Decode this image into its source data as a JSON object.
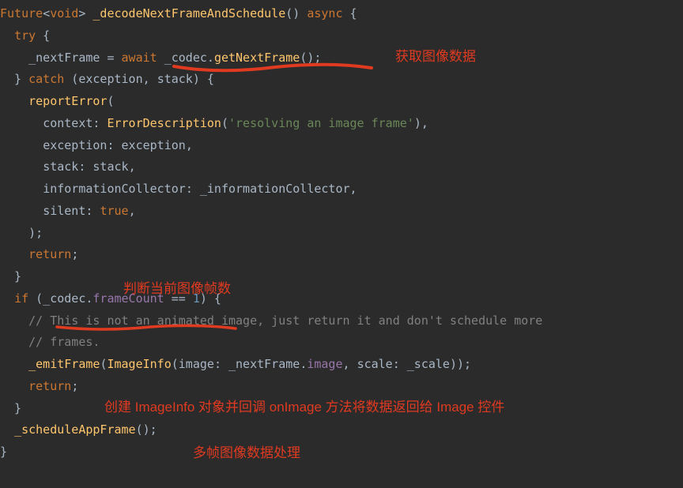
{
  "code": {
    "l1_future": "Future",
    "l1_void": "void",
    "l1_fn": "_decodeNextFrameAndSchedule",
    "l1_async": "async",
    "l2_try": "try",
    "l3_nextFrame": "_nextFrame",
    "l3_await": "await",
    "l3_codec": "_codec",
    "l3_getNextFrame": "getNextFrame",
    "l4_catch": "catch",
    "l4_exc": "exception",
    "l4_stack": "stack",
    "l5_reportError": "reportError",
    "l6_context": "context",
    "l6_ErrorDescription": "ErrorDescription",
    "l6_str": "'resolving an image frame'",
    "l7_exception_k": "exception",
    "l7_exception_v": "exception",
    "l8_stack_k": "stack",
    "l8_stack_v": "stack",
    "l9_infoColl_k": "informationCollector",
    "l9_infoColl_v": "_informationCollector",
    "l10_silent": "silent",
    "l10_true": "true",
    "l12_return": "return",
    "l14_if": "if",
    "l14_codec": "_codec",
    "l14_frameCount": "frameCount",
    "l14_num": "1",
    "l15_cmt": "// This is not an animated image, just return it and don't schedule more",
    "l16_cmt": "// frames.",
    "l17_emitFrame": "_emitFrame",
    "l17_ImageInfo": "ImageInfo",
    "l17_image_k": "image",
    "l17_nextFrame": "_nextFrame",
    "l17_image_p": "image",
    "l17_scale_k": "scale",
    "l17_scale_v": "_scale",
    "l18_return": "return",
    "l20_scheduleAppFrame": "_scheduleAppFrame"
  },
  "annotations": {
    "a1": "获取图像数据",
    "a2": "判断当前图像帧数",
    "a3": "创建 ImageInfo 对象并回调 onImage 方法将数据返回给 Image 控件",
    "a4": "多帧图像数据处理"
  }
}
